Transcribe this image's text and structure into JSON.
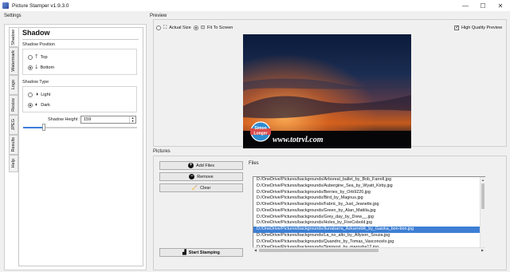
{
  "window": {
    "title": "Picture Stamper v1.9.3.0",
    "controls": [
      "—",
      "☐",
      "✕"
    ]
  },
  "sections": {
    "settings": "Settings",
    "preview": "Preview",
    "pictures": "Pictures",
    "files": "Files"
  },
  "tabs": [
    "Shadow",
    "Watermark",
    "Logo",
    "Resize",
    "JPEG",
    "Results",
    "Help"
  ],
  "shadow": {
    "heading": "Shadow",
    "position_label": "Shadow Position",
    "position_options": [
      {
        "label": "Top",
        "selected": false
      },
      {
        "label": "Bottom",
        "selected": true
      }
    ],
    "type_label": "Shadow Type",
    "type_options": [
      {
        "label": "Light",
        "selected": false
      },
      {
        "label": "Dark",
        "selected": true
      }
    ],
    "height_label": "Shadow Height :",
    "height_value": "159",
    "slider_fraction": 0.18
  },
  "preview": {
    "actual_size_label": "Actual Size",
    "fit_to_screen_label": "Fit To Screen",
    "fit_to_screen_selected": true,
    "actual_size_selected": false,
    "high_quality_label": "High Quality Preview",
    "high_quality_checked": true,
    "watermark_text": "www.totrvl.com",
    "logo_top": "Simon",
    "logo_bottom": "Longer"
  },
  "buttons": {
    "add_files": "Add Files",
    "remove": "Remove",
    "clear": "Clear",
    "start_stamping": "Start Stamping"
  },
  "files": [
    "D:/OneDrive/Pictures/backgrounds/Arboreal_ballet_by_Bob_Farrell.jpg",
    "D:/OneDrive/Pictures/backgrounds/Aubergine_Sea_by_Wyatt_Kirby.jpg",
    "D:/OneDrive/Pictures/backgrounds/Berries_by_Orb9220.jpg",
    "D:/OneDrive/Pictures/backgrounds/Bird_by_Magnus.jpg",
    "D:/OneDrive/Pictures/backgrounds/Fabric_by_Just_Jeanette.jpg",
    "D:/OneDrive/Pictures/backgrounds/Green_by_Alan_Mattila.jpg",
    "D:/OneDrive/Pictures/backgrounds/Grey_day_by_Drew__.jpg",
    "D:/OneDrive/Pictures/backgrounds/Holes_by_FireCobold.jpg",
    "D:/OneDrive/Pictures/backgrounds/Ilunabarra_Azkarreblk_by_Gaizka_bon-bon.jpg",
    "D:/OneDrive/Pictures/backgrounds/La_no_alto_by_Allyson_Souza.jpg",
    "D:/OneDrive/Pictures/backgrounds/Quandro_by_Tomas_Vasconcelo.jpg",
    "D:/OneDrive/Pictures/backgrounds/Signpost_by_marouba12.jpg"
  ],
  "selected_file_index": 8,
  "colors": {
    "selection": "#3d7fd4",
    "slider": "#3b7fd8"
  }
}
